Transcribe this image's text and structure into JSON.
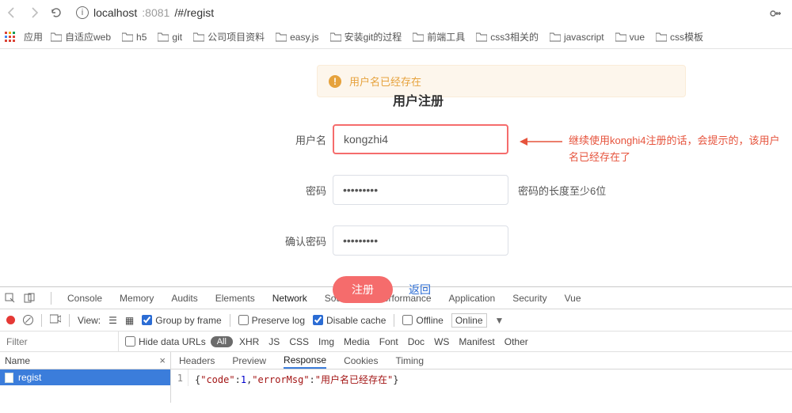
{
  "nav": {
    "url_host": "localhost",
    "url_port": ":8081",
    "url_path": "/#/regist"
  },
  "bookmarks": {
    "apps": "应用",
    "items": [
      "自适应web",
      "h5",
      "git",
      "公司项目资料",
      "easy.js",
      "安装git的过程",
      "前端工具",
      "css3相关的",
      "javascript",
      "vue",
      "css模板"
    ]
  },
  "alert": {
    "text": "用户名已经存在"
  },
  "page": {
    "title": "用户注册"
  },
  "form": {
    "username_label": "用户名",
    "username_value": "kongzhi4",
    "password_label": "密码",
    "password_value": "•••••••••",
    "password_hint": "密码的长度至少6位",
    "confirm_label": "确认密码",
    "confirm_value": "•••••••••",
    "submit": "注册",
    "back": "返回"
  },
  "annotation": "继续使用konghi4注册的话，会提示的，该用户名已经存在了",
  "dev": {
    "tabs": [
      "Console",
      "Memory",
      "Audits",
      "Elements",
      "Network",
      "Sources",
      "Performance",
      "Application",
      "Security",
      "Vue"
    ],
    "active_tab": "Network",
    "row2": {
      "view": "View:",
      "group": "Group by frame",
      "preserve": "Preserve log",
      "disable": "Disable cache",
      "offline": "Offline",
      "online": "Online"
    },
    "row3": {
      "filter_placeholder": "Filter",
      "hide": "Hide data URLs",
      "all": "All",
      "types": [
        "XHR",
        "JS",
        "CSS",
        "Img",
        "Media",
        "Font",
        "Doc",
        "WS",
        "Manifest",
        "Other"
      ]
    },
    "left": {
      "name_col": "Name",
      "req": "regist"
    },
    "resp_tabs": [
      "Headers",
      "Preview",
      "Response",
      "Cookies",
      "Timing"
    ],
    "resp_active": "Response",
    "response": {
      "line": "1",
      "code_k": "\"code\"",
      "code_v": "1",
      "err_k": "\"errorMsg\"",
      "err_v": "\"用户名已经存在\""
    }
  }
}
